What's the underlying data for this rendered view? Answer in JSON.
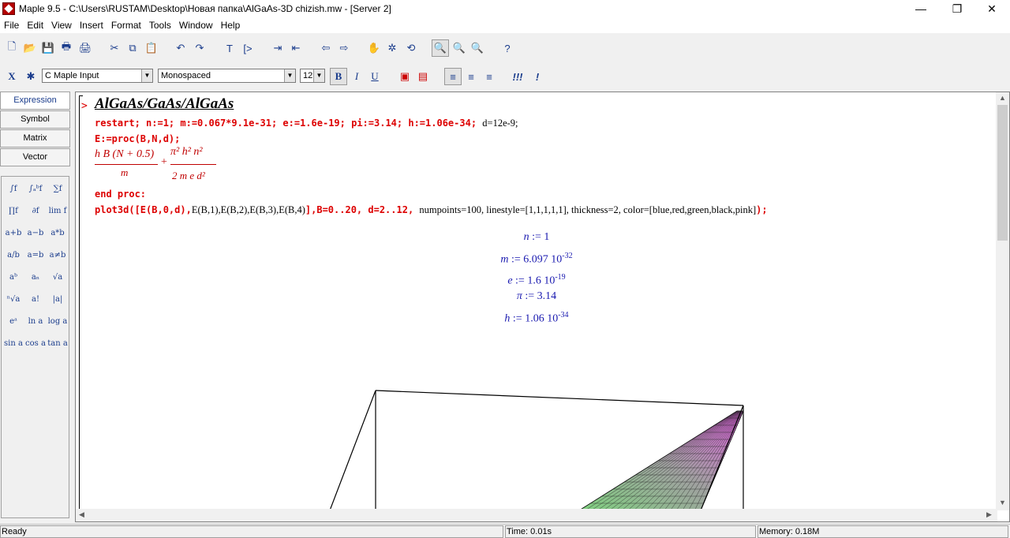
{
  "window": {
    "title": "Maple 9.5 - C:\\Users\\RUSTAM\\Desktop\\Новая папка\\AlGaAs-3D chizish.mw - [Server 2]",
    "minimize": "—",
    "restore": "❐",
    "close": "✕"
  },
  "menu": [
    "File",
    "Edit",
    "View",
    "Insert",
    "Format",
    "Tools",
    "Window",
    "Help"
  ],
  "toolbar2": {
    "x_label": "X",
    "style_label": "C  Maple Input",
    "font_label": "Monospaced",
    "size_label": "12",
    "bold": "B",
    "italic": "I",
    "underline": "U",
    "exec": "!!!",
    "exec_one": "!"
  },
  "palette": {
    "tabs": [
      "Expression",
      "Symbol",
      "Matrix",
      "Vector"
    ],
    "symbols": [
      "∫f",
      "∫ₐᵇf",
      "∑f",
      "∏f",
      "∂f",
      "lim f",
      "a+b",
      "a−b",
      "a*b",
      "a/b",
      "a=b",
      "a≠b",
      "aᵇ",
      "aₙ",
      "√a",
      "ⁿ√a",
      "a!",
      "|a|",
      "eᵃ",
      "ln a",
      "log a",
      "sin a",
      "cos a",
      "tan a"
    ]
  },
  "worksheet": {
    "prompt": ">",
    "heading": "AlGaAs/GaAs/AlGaAs",
    "line1_code": "restart; n:=1; m:=0.067*9.1e-31; e:=1.6e-19; pi:=3.14; h:=1.06e-34;",
    "line1_plain": "d=12e-9;",
    "line2_code": "E:=proc(B,N,d);",
    "formula": {
      "num1": "h B (N + 0.5)",
      "den1": "m",
      "plus": "+",
      "num2": "π² h² n²",
      "den2": "2 m e d²"
    },
    "line3_code": "end proc:",
    "line4_code_a": "plot3d([E(B,0,d),",
    "line4_plain_a": "E(B,1),E(B,2),E(B,3),E(B,4)",
    "line4_code_b": "],B=0..20, d=2..12,",
    "line4_plain_b": "numpoints=100, linestyle=[1,1,1,1,1], thickness=2, color=[blue,red,green,black,pink]",
    "line4_code_c": ");",
    "outputs": [
      {
        "lhs": "n",
        "rhs": "1",
        "exp": ""
      },
      {
        "lhs": "m",
        "rhs": "6.097 10",
        "exp": "-32"
      },
      {
        "lhs": "e",
        "rhs": "1.6 10",
        "exp": "-19"
      },
      {
        "lhs": "π",
        "rhs": "3.14",
        "exp": ""
      },
      {
        "lhs": "h",
        "rhs": "1.06 10",
        "exp": "-34"
      }
    ]
  },
  "status": {
    "ready": "Ready",
    "time": "Time: 0.01s",
    "memory": "Memory: 0.18M"
  },
  "colors": {
    "code_red": "#d00000",
    "output_blue": "#1a1ab0",
    "surface_green": "#7fd07f",
    "surface_pink": "#e060e0"
  }
}
